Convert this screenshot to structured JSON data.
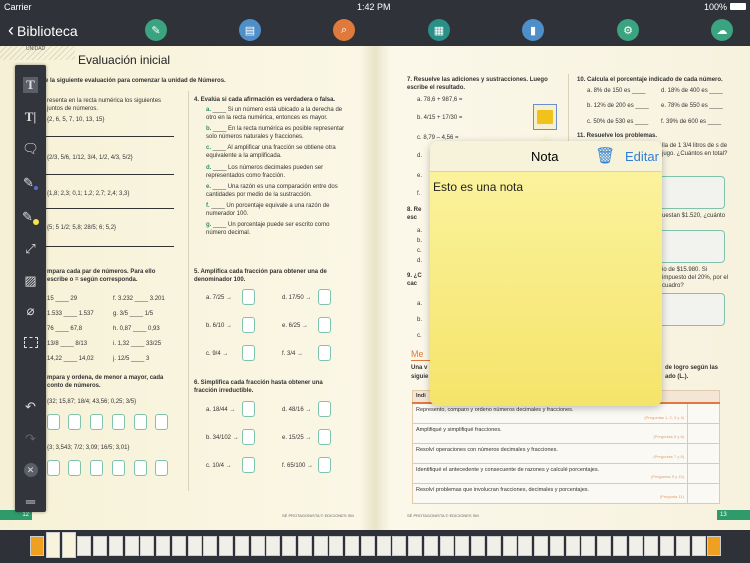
{
  "status": {
    "carrier": "Carrier",
    "time": "1:42 PM",
    "battery": "100%"
  },
  "nav": {
    "back_label": "Biblioteca",
    "icons": [
      {
        "name": "edit-icon",
        "color": "#3aa37f"
      },
      {
        "name": "clipboard-icon",
        "color": "#4f8fc9"
      },
      {
        "name": "search-icon",
        "color": "#e07a3c"
      },
      {
        "name": "grid-icon",
        "color": "#2a8f86"
      },
      {
        "name": "book-icon",
        "color": "#4f8fc9"
      },
      {
        "name": "settings-icon",
        "color": "#3aa37f"
      },
      {
        "name": "cloud-upload-icon",
        "color": "#3aa37f"
      }
    ]
  },
  "left": {
    "unidad": "UNIDAD",
    "title": "Evaluación inicial",
    "intro": "e la siguiente evaluación para comenzar la unidad de Números.",
    "q1": "resenta en la recta numérica los siguientes juntos de números.",
    "sets": [
      "{2, 6, 5, 7, 10, 13, 15}",
      "{2/3, 5/6, 1/12, 3/4, 1/2, 4/3, 5/2}",
      "{1,8; 2,3; 0,1; 1,2; 2,7; 2,4; 3,3}",
      "{5; 5 1/2; 5,8; 28/5; 6; 5,2}"
    ],
    "q2": "mpara cada par de números. Para ello escribe o = según corresponda.",
    "pairs": [
      "15 ____ 29",
      "1.533 ____ 1.537",
      "76 ____ 67,8",
      "13/8 ____ 8/13",
      "14,22 ____ 14,02"
    ],
    "pairs2": [
      "f. 3.232 ____ 3.201",
      "g. 3/5 ____ 1/5",
      "h. 0,87 ____ 0,93",
      "i. 1,32 ____ 33/25",
      "j. 12/5 ____ 3"
    ],
    "q3": "mpara y ordena, de menor a mayor, cada conto de números.",
    "order_sets": [
      "{32; 15,87; 18/4; 43,56; 0,25; 3/5}",
      "{3; 3,543; 7/2; 3,09; 16/5; 3,01}"
    ],
    "footer": "SÉ PROTAGONISTA © EDICIONES SM",
    "page": "12"
  },
  "mid": {
    "q4": "4. Evalúa si cada afirmación es verdadera o falsa.",
    "statements": [
      {
        "l": "a.",
        "t": "Si un número está ubicado a la derecha de otro en la recta numérica, entonces es mayor."
      },
      {
        "l": "b.",
        "t": "En la recta numérica es posible representar solo números naturales y fracciones."
      },
      {
        "l": "c.",
        "t": "Al amplificar una fracción se obtiene otra equivalente a la amplificada."
      },
      {
        "l": "d.",
        "t": "Los números decimales pueden ser representados como fracción."
      },
      {
        "l": "e.",
        "t": "Una razón es una comparación entre dos cantidades por medio de la sustracción."
      },
      {
        "l": "f.",
        "t": "Un porcentaje equivale a una razón de numerador 100."
      },
      {
        "l": "g.",
        "t": "Un porcentaje puede ser escrito como número decimal."
      }
    ],
    "q5": "5. Amplifica cada fracción para obtener una de denominador 100.",
    "q5_items": [
      "a. 7/25 →",
      "d. 17/50 →",
      "b. 6/10 →",
      "e. 6/25 →",
      "c. 9/4 →",
      "f. 3/4 →"
    ],
    "q6": "6. Simplifica cada fracción hasta obtener una fracción irreductible.",
    "q6_items": [
      "a. 18/44 →",
      "d. 48/16 →",
      "b. 34/102 →",
      "e. 15/25 →",
      "c. 10/4 →",
      "f. 65/100 →"
    ]
  },
  "right": {
    "q7": "7. Resuelve las adiciones y sustracciones. Luego escribe el resultado.",
    "q7_items": [
      "a. 78,6 + 987,6 =",
      "b. 4/15 + 17/30 =",
      "c. 8,79 – 4,56 =",
      "d.",
      "e.",
      "f."
    ],
    "q8": "8. Re esc",
    "q8_items": [
      "a.",
      "b.",
      "c.",
      "d."
    ],
    "q9": "9. ¿C cac",
    "q9_items": [
      "a.",
      "b.",
      "c."
    ],
    "q10": "10. Calcula el porcentaje indicado de cada número.",
    "q10_items": [
      "a. 8% de 150 es ____",
      "d. 18% de 400 es ____",
      "b. 12% de 200 es ____",
      "e. 78% de 550 es ____",
      "c. 50% de 530 es ____",
      "f. 39% de 600 es ____"
    ],
    "q11": "11. Resuelve los problemas.",
    "p1": "lla de 1 3/4 litros de s de jugo. ¿Cuántos en total?",
    "p2": "uestan $1.520, ¿cuánto",
    "p3": "io de $15.980. Si impuesto del 20%, por el cuadro?",
    "me": "Me",
    "eval_text_a": "Una v",
    "eval_text_b": "siguie",
    "eval_text_c": "de logro según las",
    "eval_text_d": "ado (L.).",
    "table_header": "Indi",
    "rows": [
      {
        "t": "Represento, comparo y ordeno números decimales y fracciones.",
        "r": "(Preguntas 1, 2, 3 y 4)"
      },
      {
        "t": "Amplifiqué y simplifiqué fracciones.",
        "r": "(Preguntas 5 y 6)"
      },
      {
        "t": "Resolví operaciones con números decimales y fracciones.",
        "r": "(Preguntas 7 y 8)"
      },
      {
        "t": "Identifiqué el antecedente y consecuente de razones y calculé porcentajes.",
        "r": "(Preguntas 9 y 10)"
      },
      {
        "t": "Resolví problemas que involucran fracciones, decimales y porcentajes.",
        "r": "(Pregunta 11)"
      }
    ],
    "footer": "SÉ PROTAGONISTA © EDICIONES SM",
    "page": "13"
  },
  "note": {
    "title": "Nota",
    "edit_label": "Editar",
    "text": "Esto es una nota"
  },
  "toolbar": [
    "text-tool-icon",
    "text-cursor-icon",
    "comment-icon",
    "pen-blue-icon",
    "highlighter-yellow-icon",
    "line-arrow-icon",
    "image-icon",
    "eraser-icon",
    "selection-icon",
    "undo-icon",
    "redo-icon",
    "close-icon",
    "menu-icon"
  ]
}
